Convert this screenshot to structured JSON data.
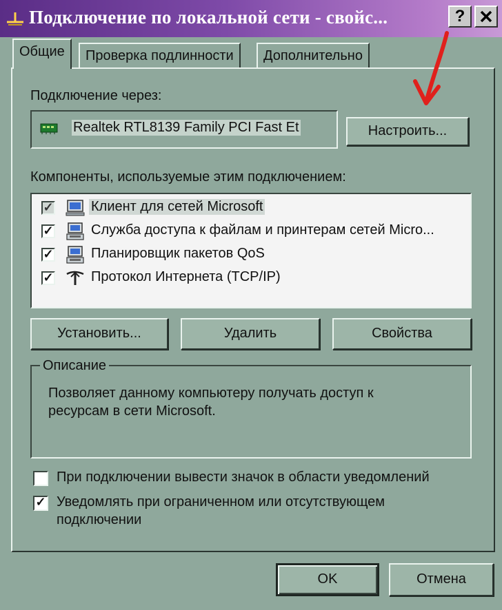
{
  "window": {
    "title": "Подключение по локальной сети - свойс...",
    "help_label": "?",
    "close_label": "X"
  },
  "tabs": [
    "Общие",
    "Проверка подлинности",
    "Дополнительно"
  ],
  "connect_via": {
    "label": "Подключение через:",
    "adapter": "Realtek RTL8139 Family PCI Fast Et",
    "configure_button": "Настроить..."
  },
  "components": {
    "label": "Компоненты, используемые этим подключением:",
    "items": [
      {
        "label": "Клиент для сетей Microsoft",
        "checked": true,
        "icon": "network-client-icon"
      },
      {
        "label": "Служба доступа к файлам и принтерам сетей Micro...",
        "checked": true,
        "icon": "file-printer-sharing-icon"
      },
      {
        "label": "Планировщик пакетов QoS",
        "checked": true,
        "icon": "qos-scheduler-icon"
      },
      {
        "label": "Протокол Интернета (TCP/IP)",
        "checked": true,
        "icon": "protocol-icon"
      }
    ]
  },
  "buttons": {
    "install": "Установить...",
    "remove": "Удалить",
    "properties": "Свойства"
  },
  "description": {
    "legend": "Описание",
    "line1": "Позволяет данному компьютеру получать доступ к",
    "line2": "ресурсам в сети Microsoft."
  },
  "options": {
    "show_icon": {
      "label": "При подключении вывести значок в области уведомлений",
      "checked": false
    },
    "notify": {
      "line1": "Уведомлять при ограниченном или отсутствующем",
      "line2": "подключении",
      "checked": true
    }
  },
  "footer": {
    "ok": "OK",
    "cancel": "Отмена"
  },
  "colors": {
    "dialog_bg": "#8fa89c",
    "title_gradient_start": "#5a2d86",
    "annotation_arrow": "#e0201c"
  }
}
